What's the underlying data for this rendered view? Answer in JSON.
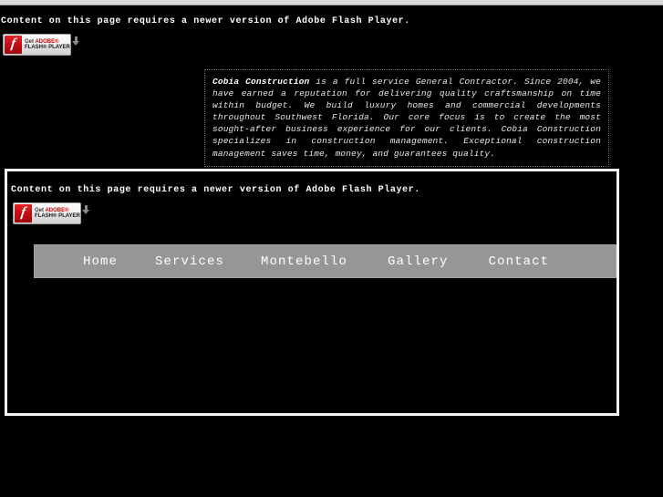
{
  "page": {
    "background_color": "#000000",
    "chrome_strip_color": "#d9d9d9"
  },
  "flash_notice": {
    "text": "Content on this page requires a newer version of Adobe Flash Player."
  },
  "flash_badge": {
    "logo_glyph": "f",
    "line1_prefix": "Get ",
    "line1_brand": "ADOBE®",
    "line2": "FLASH® PLAYER",
    "download_icon": "download-arrow-icon",
    "brand_color": "#cc0000",
    "logo_bg_color": "#c10d14"
  },
  "about": {
    "company": "Cobia Construction",
    "body": " is a full service General Contractor. Since 2004, we have earned a reputation for delivering quality craftsmanship on time within budget. We build luxury homes and commercial developments throughout Southwest Florida. Our core focus is to create the most sought-after business experience for our clients. Cobia Construction specializes in construction management. Exceptional construction management saves time, money, and guarantees quality.",
    "border_style": "dotted",
    "text_color": "#e8e8e8"
  },
  "navbar": {
    "background_color": "#969696",
    "text_color": "#ffffff",
    "items": [
      {
        "label": "Home"
      },
      {
        "label": "Services"
      },
      {
        "label": "Montebello"
      },
      {
        "label": "Gallery"
      },
      {
        "label": "Contact"
      }
    ]
  }
}
